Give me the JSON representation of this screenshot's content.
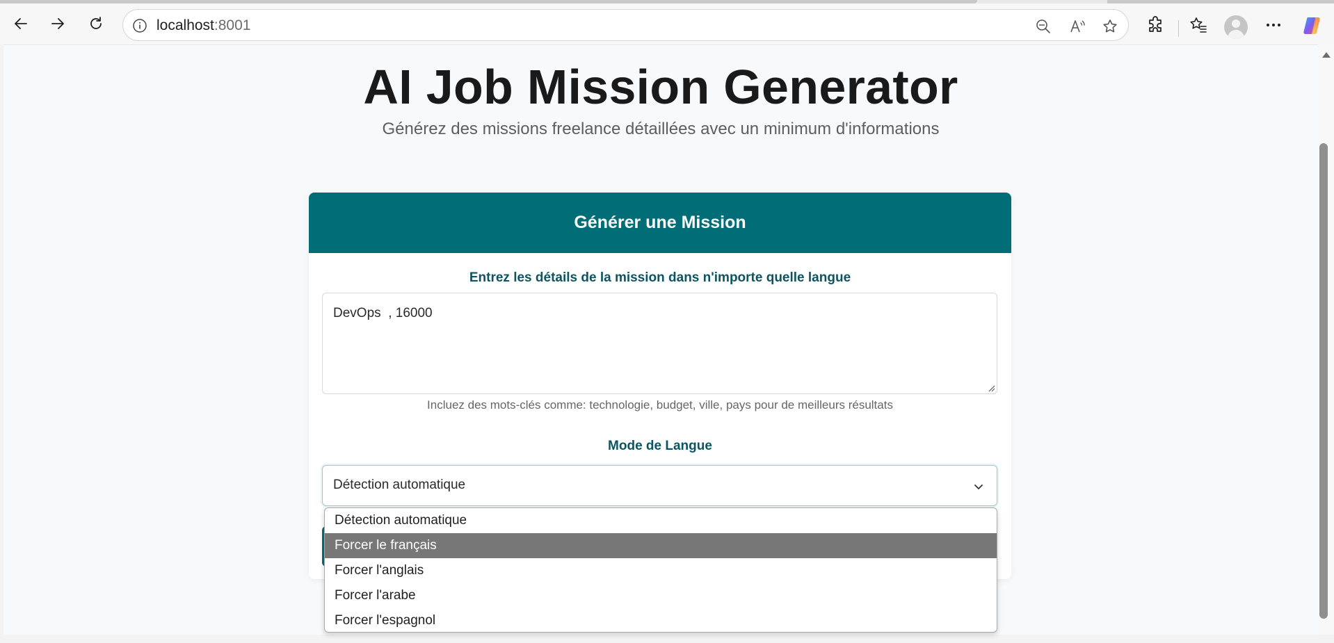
{
  "browser": {
    "url_host": "localhost",
    "url_port": ":8001",
    "icons": {
      "back": "arrow-left-icon",
      "forward": "arrow-right-icon",
      "refresh": "refresh-icon",
      "site_info": "info-icon",
      "zoom": "zoom-out-icon",
      "read_aloud": "read-aloud-icon",
      "favorite": "star-icon",
      "extensions": "puzzle-icon",
      "favorites_list": "favorites-icon",
      "profile": "avatar-icon",
      "more": "ellipsis-icon",
      "copilot": "copilot-icon"
    }
  },
  "page": {
    "title": "AI Job Mission Generator",
    "subtitle": "Générez des missions freelance détaillées avec un minimum d'informations"
  },
  "card": {
    "header": "Générer une Mission",
    "details_label": "Entrez les détails de la mission dans n'importe quelle langue",
    "details_value": "DevOps  , 16000",
    "hint": "Incluez des mots-clés comme: technologie, budget, ville, pays pour de meilleurs résultats",
    "language_label": "Mode de Langue",
    "language_selected": "Détection automatique"
  },
  "dropdown": {
    "options": [
      "Détection automatique",
      "Forcer le français",
      "Forcer l'anglais",
      "Forcer l'arabe",
      "Forcer l'espagnol"
    ],
    "highlighted": "Forcer le français"
  },
  "colors": {
    "accent": "#006d77",
    "label": "#0b5560",
    "highlight": "#777777"
  }
}
